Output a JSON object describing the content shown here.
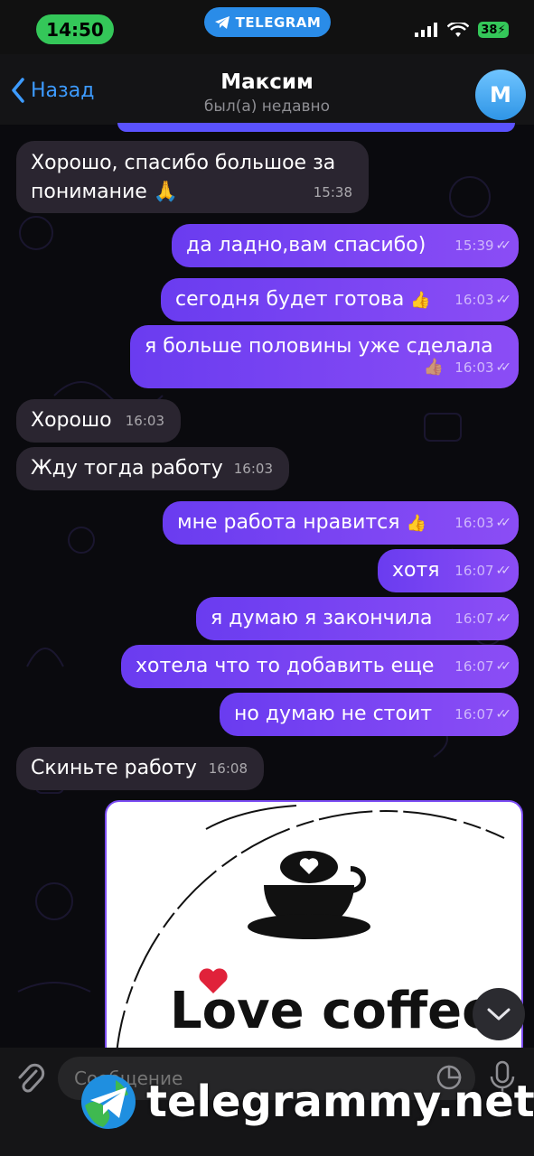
{
  "status": {
    "time": "14:50",
    "app_badge": "TELEGRAM",
    "battery": "38"
  },
  "header": {
    "back_label": "Назад",
    "title": "Максим",
    "subtitle": "был(а) недавно",
    "avatar_letter": "М"
  },
  "messages": [
    {
      "dir": "in",
      "line1": "Хорошо, спасибо большое за",
      "line2": "понимание",
      "emoji": "🙏",
      "time": "15:38"
    },
    {
      "dir": "out",
      "text": "да ладно,вам спасибо)",
      "time": "15:39"
    },
    {
      "dir": "out",
      "text": "сегодня будет готова",
      "emoji": "👍",
      "time": "16:03"
    },
    {
      "dir": "out",
      "text": "я больше половины уже сделала",
      "emoji": "👍",
      "time": "16:03"
    },
    {
      "dir": "in",
      "text": "Хорошо",
      "time": "16:03"
    },
    {
      "dir": "in",
      "text": "Жду тогда работу",
      "time": "16:03"
    },
    {
      "dir": "out",
      "text": "мне работа нравится",
      "emoji": "👍",
      "time": "16:03"
    },
    {
      "dir": "out",
      "text": "хотя",
      "time": "16:07"
    },
    {
      "dir": "out",
      "text": "я думаю я закончила",
      "time": "16:07"
    },
    {
      "dir": "out",
      "text": "хотела что то добавить еще",
      "time": "16:07"
    },
    {
      "dir": "out",
      "text": "но думаю не стоит",
      "time": "16:07"
    },
    {
      "dir": "in",
      "text": "Скиньте работу",
      "time": "16:08"
    }
  ],
  "image_message": {
    "logo_text": "Love coffee"
  },
  "input": {
    "placeholder": "Сообщение"
  },
  "watermark": {
    "text": "telegrammy.net"
  },
  "colors": {
    "outgoing": "#7a45f2",
    "incoming": "#2a2530",
    "accent": "#3d9bff"
  }
}
